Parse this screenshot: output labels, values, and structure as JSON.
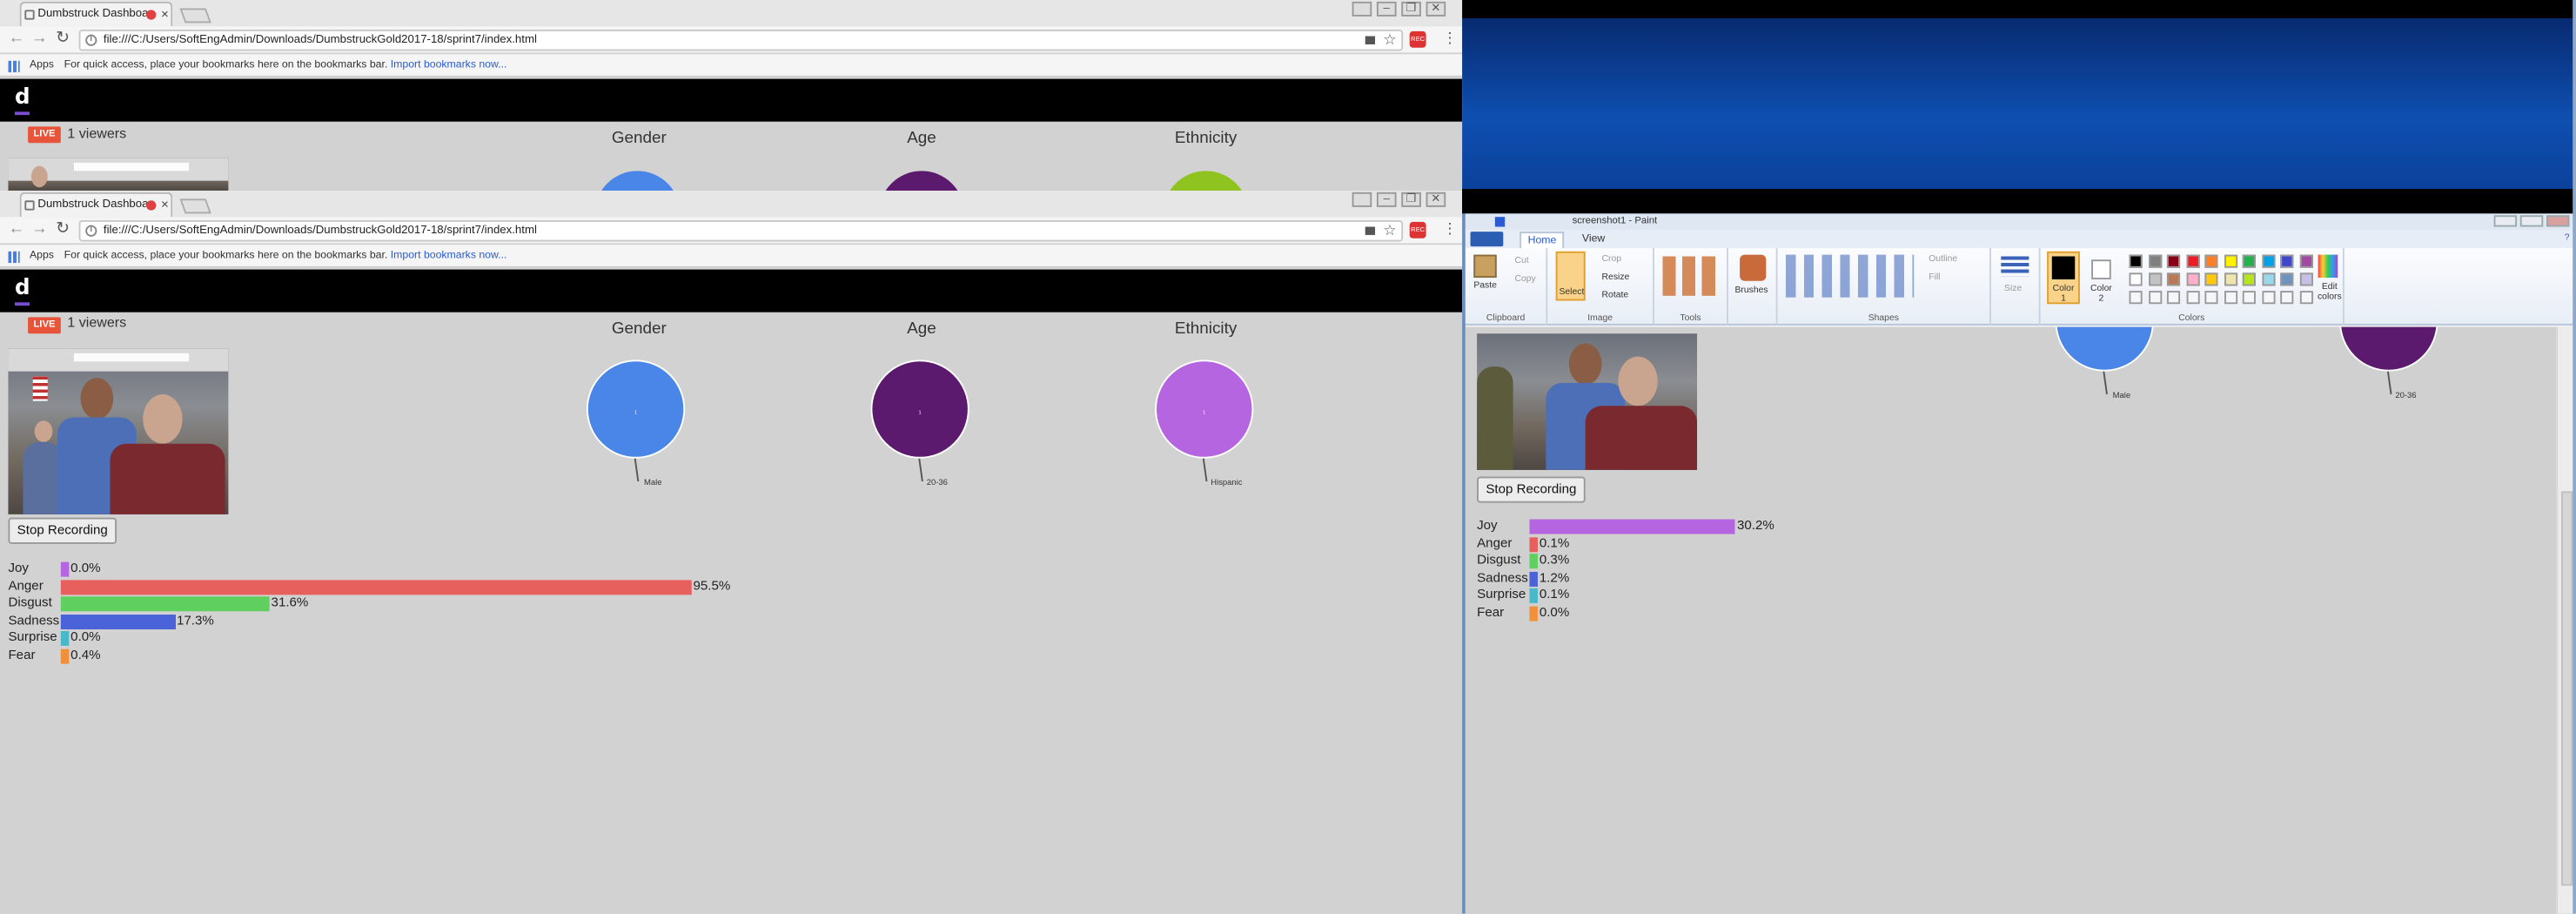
{
  "browser": {
    "tab_title": "Dumbstruck Dashboa",
    "url": "file:///C:/Users/SoftEngAdmin/Downloads/DumbstruckGold2017-18/sprint7/index.html",
    "bookmarks_apps": "Apps",
    "bookmarks_hint": "For quick access, place your bookmarks here on the bookmarks bar.",
    "bookmarks_import": "Import bookmarks now...",
    "ext_label": "REC"
  },
  "dashboard": {
    "logo": "d",
    "live_badge": "LIVE",
    "viewers": "1 viewers",
    "gender_title": "Gender",
    "age_title": "Age",
    "ethnicity_title": "Ethnicity",
    "gender_pie": {
      "label": "Male",
      "value": "1",
      "color": "#4a86e8"
    },
    "age_pie": {
      "label": "20-36",
      "value": "1",
      "color": "#5b1a6e"
    },
    "ethnicity_pie": {
      "label": "Hispanic",
      "value": "1",
      "color": "#b565e0"
    },
    "stop_button": "Stop Recording",
    "emotions": [
      {
        "name": "Joy",
        "value": 0.0,
        "display": "0.0%",
        "color": "#b565e0"
      },
      {
        "name": "Anger",
        "value": 95.5,
        "display": "95.5%",
        "color": "#e8605e"
      },
      {
        "name": "Disgust",
        "value": 31.6,
        "display": "31.6%",
        "color": "#5fcf5f"
      },
      {
        "name": "Sadness",
        "value": 17.3,
        "display": "17.3%",
        "color": "#4a63d8"
      },
      {
        "name": "Surprise",
        "value": 0.0,
        "display": "0.0%",
        "color": "#49b8c8"
      },
      {
        "name": "Fear",
        "value": 0.4,
        "display": "0.4%",
        "color": "#f0903a"
      }
    ]
  },
  "paint": {
    "title": "screenshot1 - Paint",
    "tab_home": "Home",
    "tab_view": "View",
    "paste": "Paste",
    "cut": "Cut",
    "copy": "Copy",
    "select": "Select",
    "crop": "Crop",
    "resize": "Resize",
    "rotate": "Rotate",
    "brushes": "Brushes",
    "outline": "Outline",
    "fill": "Fill",
    "size": "Size",
    "color1": "Color 1",
    "color2": "Color 2",
    "edit_colors": "Edit colors",
    "groups": {
      "clipboard": "Clipboard",
      "image": "Image",
      "tools": "Tools",
      "shapes": "Shapes",
      "colors": "Colors"
    },
    "palette": [
      "#000000",
      "#7f7f7f",
      "#880015",
      "#ed1c24",
      "#ff7f27",
      "#fff200",
      "#22b14c",
      "#00a2e8",
      "#3f48cc",
      "#a349a4",
      "#ffffff",
      "#c3c3c3",
      "#b97a57",
      "#ffaec9",
      "#ffc90e",
      "#efe4b0",
      "#b5e61d",
      "#99d9ea",
      "#7092be",
      "#c8bfe7"
    ],
    "canvas": {
      "gender_pie": {
        "label": "Male",
        "value": "1",
        "color": "#4a86e8"
      },
      "age_pie": {
        "label": "20-36",
        "value": "1",
        "color": "#5b1a6e"
      },
      "stop_button": "Stop Recording",
      "emotions": [
        {
          "name": "Joy",
          "value": 30.2,
          "display": "30.2%",
          "color": "#b565e0"
        },
        {
          "name": "Anger",
          "value": 0.1,
          "display": "0.1%",
          "color": "#e8605e"
        },
        {
          "name": "Disgust",
          "value": 0.3,
          "display": "0.3%",
          "color": "#5fcf5f"
        },
        {
          "name": "Sadness",
          "value": 1.2,
          "display": "1.2%",
          "color": "#4a63d8"
        },
        {
          "name": "Surprise",
          "value": 0.1,
          "display": "0.1%",
          "color": "#49b8c8"
        },
        {
          "name": "Fear",
          "value": 0.0,
          "display": "0.0%",
          "color": "#f0903a"
        }
      ]
    }
  }
}
